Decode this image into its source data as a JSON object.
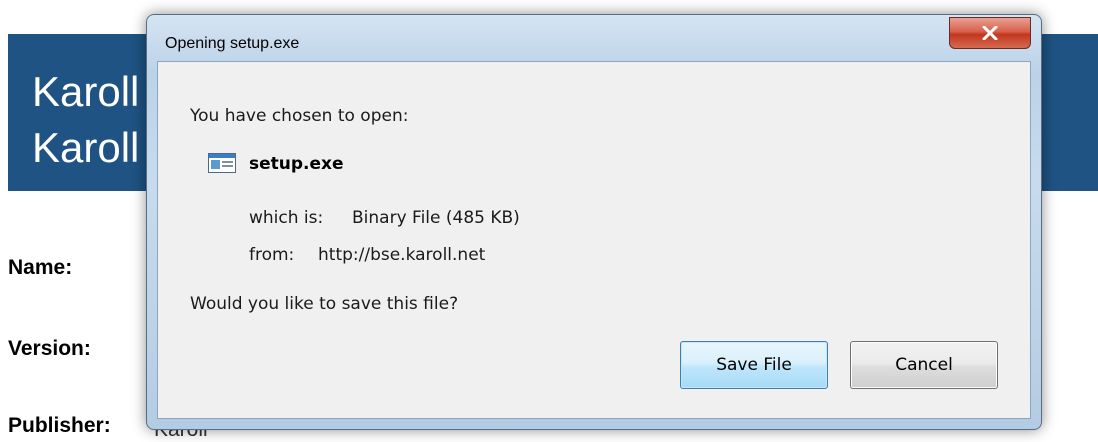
{
  "background_page": {
    "banner_title": "Karoll\nKaroll",
    "labels": {
      "name": "Name:",
      "version": "Version:",
      "publisher": "Publisher:"
    },
    "publisher_value": "Karoll"
  },
  "dialog": {
    "title": "Opening setup.exe",
    "intro": "You have chosen to open:",
    "file_name": "setup.exe",
    "which_is_label": "which is:",
    "which_is_value": "Binary File (485 KB)",
    "from_label": "from:",
    "from_value": "http://bse.karoll.net",
    "question": "Would you like to save this file?",
    "buttons": {
      "save": "Save File",
      "cancel": "Cancel"
    }
  },
  "colors": {
    "banner": "#1e5383",
    "close_button": "#c9432d",
    "default_button_border": "#3c7fb1"
  },
  "icons": {
    "close": "close-icon",
    "file": "application-file-icon"
  }
}
